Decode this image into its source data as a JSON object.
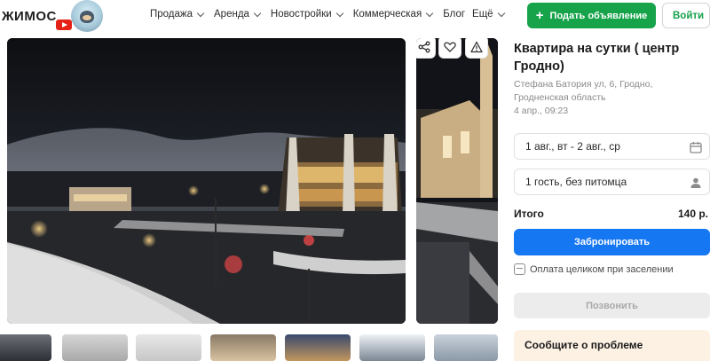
{
  "header": {
    "logo_text": "ЖИМОС",
    "nav": [
      {
        "label": "Продажа",
        "has_dropdown": true
      },
      {
        "label": "Аренда",
        "has_dropdown": true
      },
      {
        "label": "Новостройки",
        "has_dropdown": true
      },
      {
        "label": "Коммерческая",
        "has_dropdown": true
      },
      {
        "label": "Блог",
        "has_dropdown": false
      },
      {
        "label": "Ещё",
        "has_dropdown": true
      }
    ],
    "post_button": "Подать объявление",
    "login_button": "Войти"
  },
  "gallery": {
    "actions": [
      "share-icon",
      "heart-icon",
      "warning-icon"
    ],
    "thumbnail_count": 7
  },
  "listing": {
    "title": "Квартира на сутки ( центр Гродно)",
    "address": "Стефана Батория ул, 6, Гродно, Гродненская область",
    "date": "4 апр., 09:23",
    "dates_field": "1 авг., вт - 2 авг., ср",
    "guests_field": "1 гость, без питомца",
    "total_label": "Итого",
    "total_value": "140 р.",
    "book_button": "Забронировать",
    "payment_note": "Оплата целиком при заселении",
    "call_button": "Позвонить",
    "report_title": "Сообщите о проблеме"
  },
  "colors": {
    "brand_green": "#16a34a",
    "book_blue": "#1677f2",
    "report_bg": "#fdf1e3"
  }
}
